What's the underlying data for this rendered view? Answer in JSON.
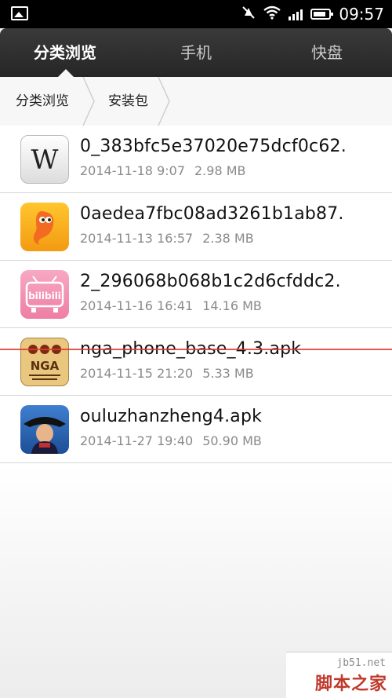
{
  "status_bar": {
    "time": "09:57",
    "icons": [
      "image-notification-icon",
      "mute-icon",
      "wifi-icon",
      "signal-icon",
      "battery-icon"
    ]
  },
  "tabs": [
    {
      "label": "分类浏览",
      "active": true
    },
    {
      "label": "手机",
      "active": false
    },
    {
      "label": "快盘",
      "active": false
    }
  ],
  "breadcrumb": [
    {
      "label": "分类浏览"
    },
    {
      "label": "安装包"
    }
  ],
  "files": [
    {
      "name": "0_383bfc5e37020e75dcf0c62.",
      "date": "2014-11-18 9:07",
      "size": "2.98 MB",
      "icon": "wikipedia-app-icon"
    },
    {
      "name": "0aedea7fbc08ad3261b1ab87.",
      "date": "2014-11-13 16:57",
      "size": "2.38 MB",
      "icon": "yellow-mascot-app-icon"
    },
    {
      "name": "2_296068b068b1c2d6cfddc2.",
      "date": "2014-11-16 16:41",
      "size": "14.16 MB",
      "icon": "bilibili-app-icon",
      "icon_text": "bilibili"
    },
    {
      "name": "nga_phone_base_4.3.apk",
      "date": "2014-11-15 21:20",
      "size": "5.33 MB",
      "icon": "nga-app-icon",
      "icon_text": "NGA"
    },
    {
      "name": "ouluzhanzheng4.apk",
      "date": "2014-11-27 19:40",
      "size": "50.90 MB",
      "icon": "napoleon-game-app-icon"
    }
  ],
  "watermark": {
    "site": "jb51.net",
    "title": "脚本之家"
  },
  "colors": {
    "tabbar": "#2e2e2e",
    "accent_line": "#e0392f",
    "watermark": "#c0392b"
  }
}
